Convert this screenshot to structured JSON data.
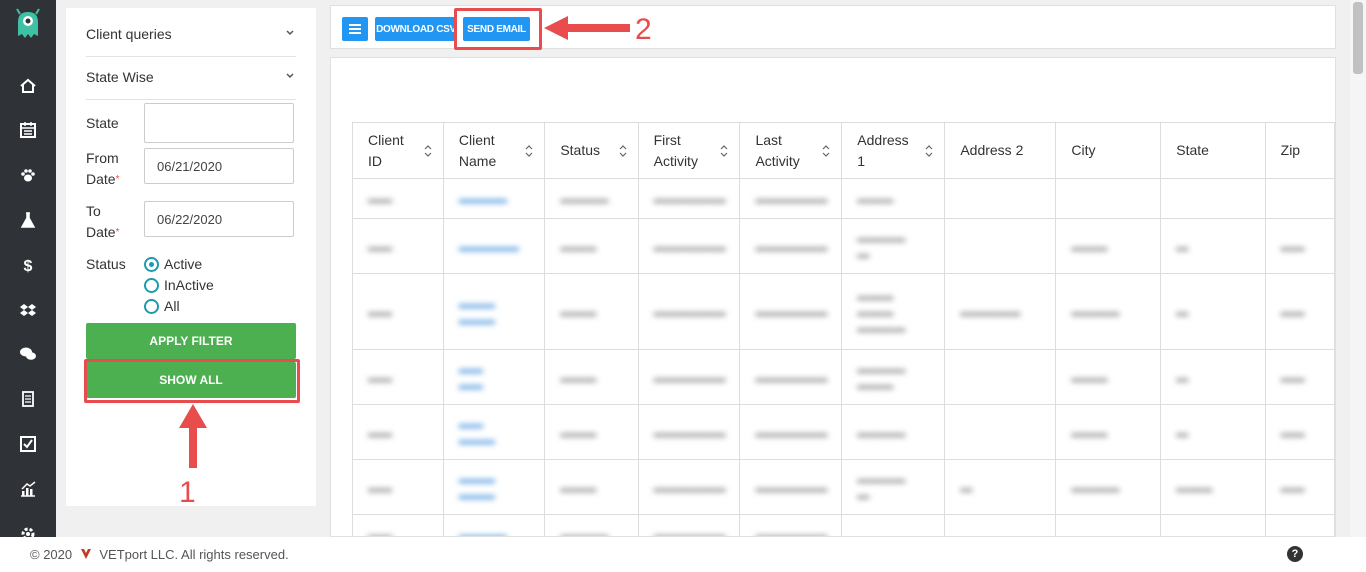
{
  "sidebar": {
    "icons": [
      "logo-monster-icon",
      "home-icon",
      "calendar-icon",
      "paw-icon",
      "flask-icon",
      "dollar-icon",
      "dropbox-icon",
      "chat-icon",
      "receipt-icon",
      "checkbox-icon",
      "chart-icon",
      "gear-icon"
    ]
  },
  "filters": {
    "query_select": "Client queries",
    "state_select": "State Wise",
    "state_label": "State",
    "state_value": "",
    "from_label_1": "From",
    "from_label_2": "Date",
    "from_value": "06/21/2020",
    "to_label_1": "To",
    "to_label_2": "Date",
    "to_value": "06/22/2020",
    "required_mark": "*",
    "status_label": "Status",
    "status_options": [
      "Active",
      "InActive",
      "All"
    ],
    "status_selected": "Active",
    "apply_label": "APPLY FILTER",
    "show_all_label": "SHOW ALL"
  },
  "toolbar": {
    "download_label": "DOWNLOAD CSV",
    "send_email_label": "SEND EMAIL"
  },
  "table": {
    "headers": [
      [
        "Client",
        "ID"
      ],
      [
        "Client",
        "Name"
      ],
      [
        "Status",
        ""
      ],
      [
        "First",
        "Activity"
      ],
      [
        "Last",
        "Activity"
      ],
      [
        "Address",
        "1"
      ],
      [
        "Address 2",
        ""
      ],
      [
        "City",
        ""
      ],
      [
        "State",
        ""
      ],
      [
        "Zip",
        ""
      ]
    ]
  },
  "annotations": {
    "label_1": "1",
    "label_2": "2",
    "accent": "#e84c4c"
  },
  "footer": {
    "copyright_pre": "© 2020",
    "copyright_post": "VETport LLC. All rights reserved.",
    "help": "?"
  },
  "colors": {
    "nav_bg": "#2f3338",
    "green": "#4caf50",
    "blue": "#2196f3",
    "teal": "#1e9ab0"
  }
}
